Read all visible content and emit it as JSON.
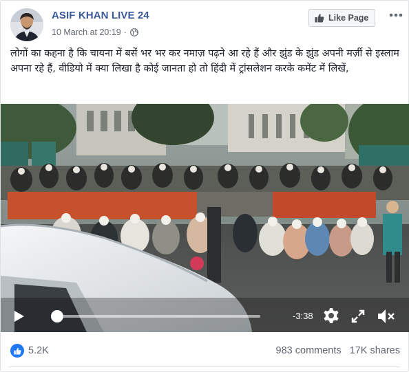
{
  "post": {
    "page_name": "ASIF KHAN LIVE 24",
    "date": "10 March at 20:19",
    "separator": "·",
    "privacy_icon": "globe-icon",
    "like_page_label": "Like Page",
    "more_icon": "more-dots-icon",
    "text": "लोगों का कहना है कि चायना में बसें भर भर कर नमाज़ पढ़ने आ रहे हैं और झुंड के झुंड अपनी मर्ज़ी से इस्लाम अपना रहे हैं, वीडियो में क्या लिखा है कोई जानता हो तो हिंदी में ट्रांसलेशन करके कमेंट में लिखें,"
  },
  "video": {
    "time_remaining": "-3:38",
    "progress": 0.0,
    "icons": [
      "play-icon",
      "settings-gear-icon",
      "fullscreen-expand-icon",
      "volume-muted-icon"
    ]
  },
  "footer": {
    "reaction_icon": "like-reaction-icon",
    "reaction_count": "5.2K",
    "comments": "983 comments",
    "shares": "17K shares"
  },
  "colors": {
    "page_name": "#385898",
    "like_blue": "#2078f4",
    "secondary_text": "#606770"
  }
}
